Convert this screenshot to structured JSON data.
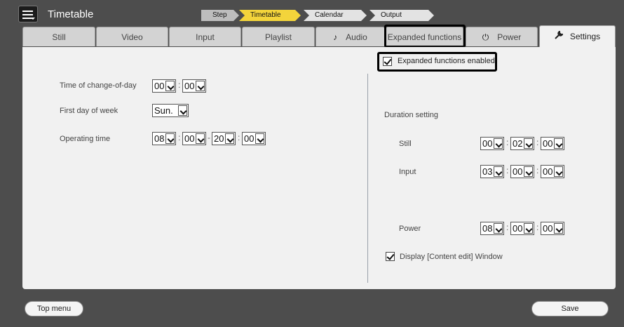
{
  "header": {
    "title": "Timetable",
    "steps": [
      "Step",
      "Timetable",
      "Calendar",
      "Output"
    ],
    "active_step": "Timetable"
  },
  "tabs": [
    {
      "label": "Still"
    },
    {
      "label": "Video"
    },
    {
      "label": "Input"
    },
    {
      "label": "Playlist"
    },
    {
      "label": "Audio",
      "icon": "music-note-icon"
    },
    {
      "label": "Expanded functions"
    },
    {
      "label": "Power",
      "icon": "power-icon"
    },
    {
      "label": "Settings",
      "icon": "wrench-icon"
    }
  ],
  "selected_tab": "Settings",
  "expanded": {
    "label": "Expanded functions enabled",
    "checked": true
  },
  "left": {
    "change_of_day": {
      "label": "Time of change-of-day",
      "hour": "00",
      "minute": "00"
    },
    "first_day": {
      "label": "First day of week",
      "value": "Sun."
    },
    "operating": {
      "label": "Operating time",
      "start_hour": "08",
      "start_minute": "00",
      "end_hour": "20",
      "end_minute": "00"
    }
  },
  "right": {
    "duration_title": "Duration setting",
    "still": {
      "label": "Still",
      "h": "00",
      "m": "02",
      "s": "00"
    },
    "input": {
      "label": "Input",
      "h": "03",
      "m": "00",
      "s": "00"
    },
    "power": {
      "label": "Power",
      "h": "08",
      "m": "00",
      "s": "00"
    },
    "display_content_edit": {
      "label": "Display [Content edit] Window",
      "checked": true
    }
  },
  "footer": {
    "top_menu": "Top menu",
    "save": "Save"
  },
  "colors": {
    "background": "#4d4d4d",
    "panel": "#f1f1f1",
    "active_step": "#f3d43b",
    "highlight": "#000000"
  }
}
